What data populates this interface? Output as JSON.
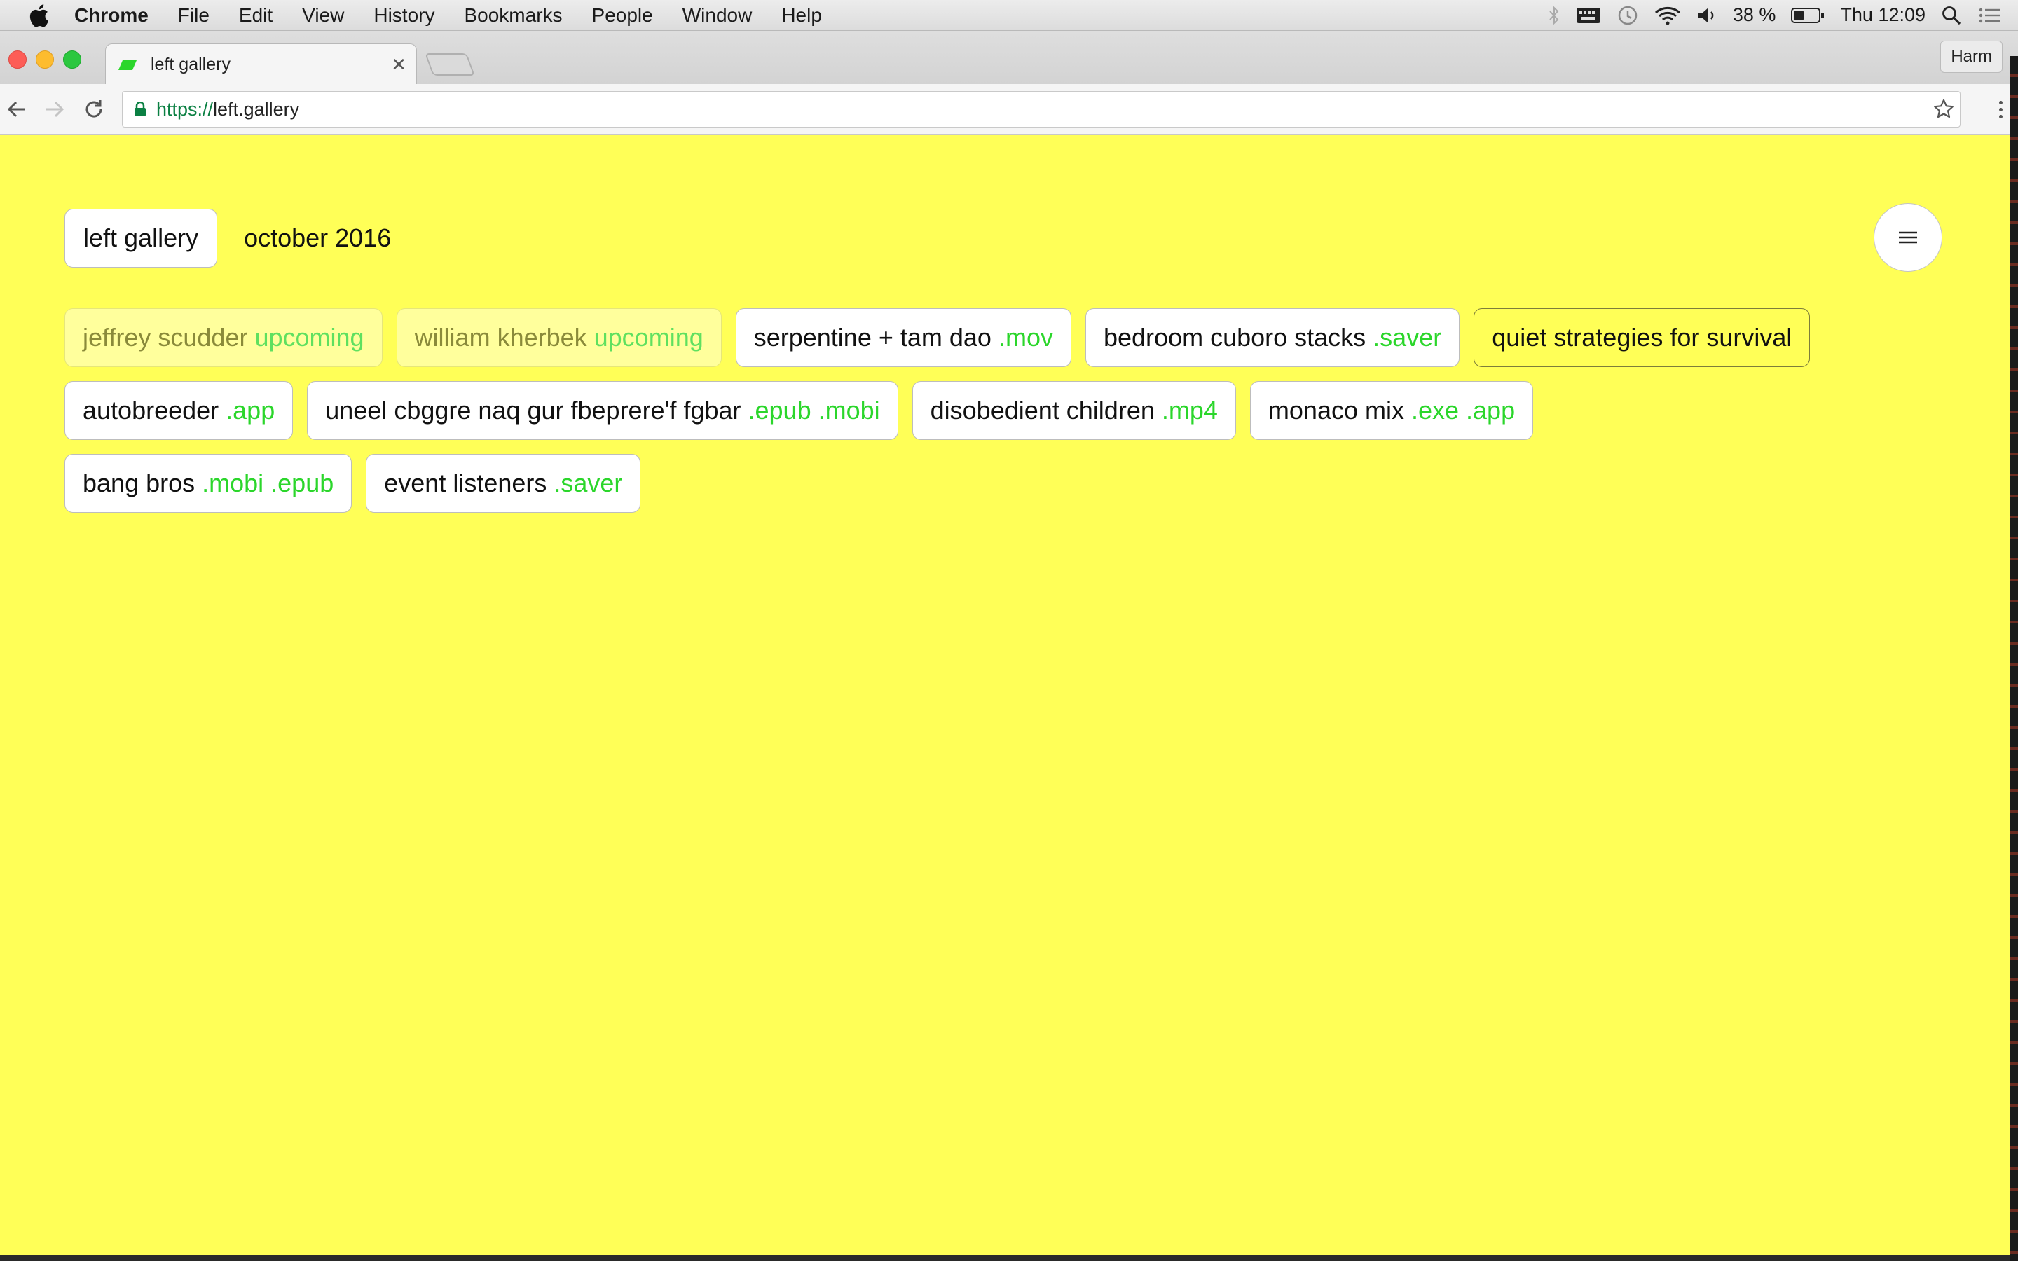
{
  "menubar": {
    "app_name": "Chrome",
    "menus": [
      "File",
      "Edit",
      "View",
      "History",
      "Bookmarks",
      "People",
      "Window",
      "Help"
    ],
    "battery": "38 %",
    "clock": "Thu 12:09"
  },
  "tabstrip": {
    "tab_title": "left gallery",
    "profile": "Harm"
  },
  "toolbar": {
    "url_scheme": "https://",
    "url_host": "left.gallery"
  },
  "page": {
    "site_name": "left gallery",
    "date": "october 2016",
    "background": "#ffff57",
    "accent": "#2bd62b",
    "rows": [
      [
        {
          "title": "jeffrey scudder",
          "ext": "upcoming",
          "state": "upcoming"
        },
        {
          "title": "william kherbek",
          "ext": "upcoming",
          "state": "upcoming"
        },
        {
          "title": "serpentine + tam dao",
          "ext": ".mov",
          "state": "normal"
        },
        {
          "title": "bedroom cuboro stacks",
          "ext": ".saver",
          "state": "normal"
        },
        {
          "title": "quiet strategies for survival",
          "ext": "",
          "state": "current"
        }
      ],
      [
        {
          "title": "autobreeder",
          "ext": ".app",
          "state": "normal"
        },
        {
          "title": "uneel cbggre naq gur fbeprere'f fgbar",
          "ext": ".epub .mobi",
          "state": "normal"
        },
        {
          "title": "disobedient children",
          "ext": ".mp4",
          "state": "normal"
        },
        {
          "title": "monaco mix",
          "ext": ".exe .app",
          "state": "normal"
        }
      ],
      [
        {
          "title": "bang bros",
          "ext": ".mobi .epub",
          "state": "normal"
        },
        {
          "title": "event listeners",
          "ext": ".saver",
          "state": "normal"
        }
      ]
    ]
  }
}
